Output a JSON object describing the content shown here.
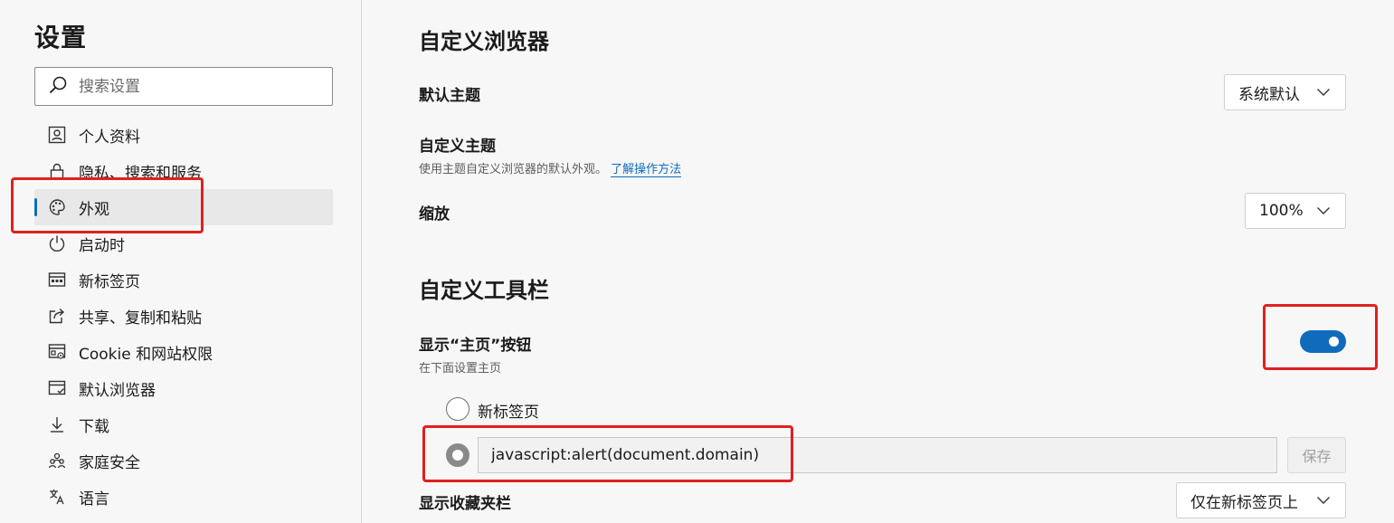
{
  "sidebar": {
    "title": "设置",
    "search_placeholder": "搜索设置",
    "items": [
      {
        "label": "个人资料",
        "icon": "profile-icon"
      },
      {
        "label": "隐私、搜索和服务",
        "icon": "lock-icon"
      },
      {
        "label": "外观",
        "icon": "palette-icon",
        "active": true
      },
      {
        "label": "启动时",
        "icon": "power-icon"
      },
      {
        "label": "新标签页",
        "icon": "new-tab-icon"
      },
      {
        "label": "共享、复制和粘贴",
        "icon": "share-icon"
      },
      {
        "label": "Cookie 和网站权限",
        "icon": "site-permissions-icon"
      },
      {
        "label": "默认浏览器",
        "icon": "default-browser-icon"
      },
      {
        "label": "下载",
        "icon": "download-icon"
      },
      {
        "label": "家庭安全",
        "icon": "family-icon"
      },
      {
        "label": "语言",
        "icon": "language-icon"
      }
    ]
  },
  "main": {
    "customize_browser": {
      "heading": "自定义浏览器",
      "default_theme_label": "默认主题",
      "default_theme_value": "系统默认",
      "custom_theme_label": "自定义主题",
      "custom_theme_desc": "使用主题自定义浏览器的默认外观。",
      "custom_theme_link": "了解操作方法",
      "zoom_label": "缩放",
      "zoom_value": "100%"
    },
    "customize_toolbar": {
      "heading": "自定义工具栏",
      "home_button_label": "显示“主页”按钮",
      "home_button_desc": "在下面设置主页",
      "home_button_enabled": true,
      "option_new_tab": "新标签页",
      "custom_url_value": "javascript:alert(document.domain)",
      "save_label": "保存",
      "favorites_bar_label": "显示收藏夹栏",
      "favorites_bar_value": "仅在新标签页上"
    }
  },
  "colors": {
    "accent": "#0f6cbd",
    "annotation": "#e02020",
    "background": "#f7f7f7"
  }
}
